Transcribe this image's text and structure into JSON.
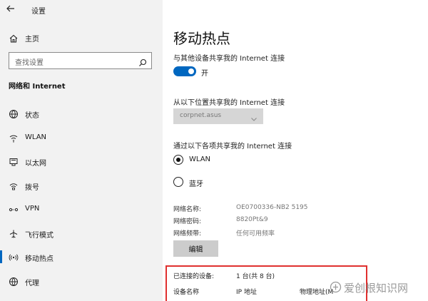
{
  "window": {
    "title": "设置",
    "back_icon": "back-arrow-icon"
  },
  "sidebar": {
    "home_label": "主页",
    "search_placeholder": "查找设置",
    "section_title": "网络和 Internet",
    "items": [
      {
        "label": "状态",
        "icon": "globe-status-icon",
        "active": false
      },
      {
        "label": "WLAN",
        "icon": "wifi-icon",
        "active": false
      },
      {
        "label": "以太网",
        "icon": "ethernet-icon",
        "active": false
      },
      {
        "label": "拨号",
        "icon": "dialup-icon",
        "active": false
      },
      {
        "label": "VPN",
        "icon": "vpn-icon",
        "active": false
      },
      {
        "label": "飞行模式",
        "icon": "airplane-icon",
        "active": false
      },
      {
        "label": "移动热点",
        "icon": "hotspot-icon",
        "active": true
      },
      {
        "label": "代理",
        "icon": "proxy-globe-icon",
        "active": false
      }
    ]
  },
  "main": {
    "page_title": "移动热点",
    "share_label": "与其他设备共享我的 Internet 连接",
    "toggle_state": "开",
    "toggle_on": true,
    "source_label": "从以下位置共享我的 Internet 连接",
    "source_value": "corpnet.asus",
    "share_over_label": "通过以下各项共享我的 Internet 连接",
    "radio_wlan": "WLAN",
    "radio_bluetooth": "蓝牙",
    "selected_option": "WLAN",
    "network_name_key": "网络名称:",
    "network_name_value": "OE0700336-NB2 5195",
    "network_password_key": "网络密码:",
    "network_password_value": "8820Pt&9",
    "network_band_key": "网络频带:",
    "network_band_value": "任何可用频率",
    "edit_button": "编辑",
    "connected_label": "已连接的设备:",
    "connected_value": "1 台(共 8 台)",
    "col_device_name": "设备名称",
    "col_ip": "IP 地址",
    "col_mac": "物理地址(M"
  },
  "watermark": {
    "text": "爱创根知识网"
  },
  "colors": {
    "accent": "#0067c0",
    "highlight": "#e0302f",
    "sidebar_bg": "#f2f2f2"
  }
}
